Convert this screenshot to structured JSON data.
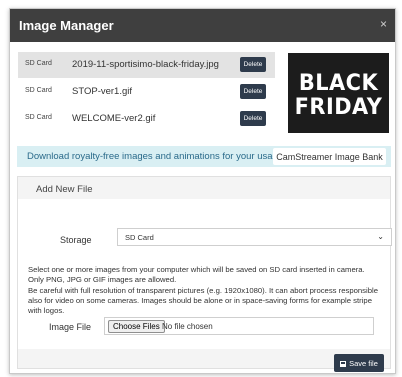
{
  "header": {
    "title": "Image Manager",
    "close_symbol": "×"
  },
  "files": [
    {
      "location": "SD Card",
      "name": "2019-11-sportisimo-black-friday.jpg",
      "delete_label": "Delete",
      "selected": true
    },
    {
      "location": "SD Card",
      "name": "STOP-ver1.gif",
      "delete_label": "Delete",
      "selected": false
    },
    {
      "location": "SD Card",
      "name": "WELCOME-ver2.gif",
      "delete_label": "Delete",
      "selected": false
    }
  ],
  "preview": {
    "line1": "BLACK",
    "line2": "FRIDAY"
  },
  "banner": {
    "text": "Download royalty-free images and animations for your usage.",
    "button_label": "CamStreamer Image Bank"
  },
  "add_file": {
    "title": "Add New File",
    "storage_label": "Storage",
    "storage_value": "SD Card",
    "info_lines": [
      "Select one or more images from your computer which will be saved on SD card inserted in camera.",
      "Only PNG, JPG or GIF images are allowed.",
      "Be careful with full resolution of transparent pictures (e.g. 1920x1080). It can abort process responsible",
      "also for video on some cameras. Images should be alone or in space-saving forms for example stripe",
      "with logos."
    ],
    "image_file_label": "Image File",
    "choose_label": "Choose Files",
    "no_file_text": "No file chosen",
    "save_label": "Save file"
  },
  "colors": {
    "header_bg": "#3f3f3f",
    "button_dark": "#2e3b4c",
    "banner_bg": "#d9eff3",
    "banner_text": "#2a6a8a",
    "selected_row": "#e3e3e3"
  }
}
